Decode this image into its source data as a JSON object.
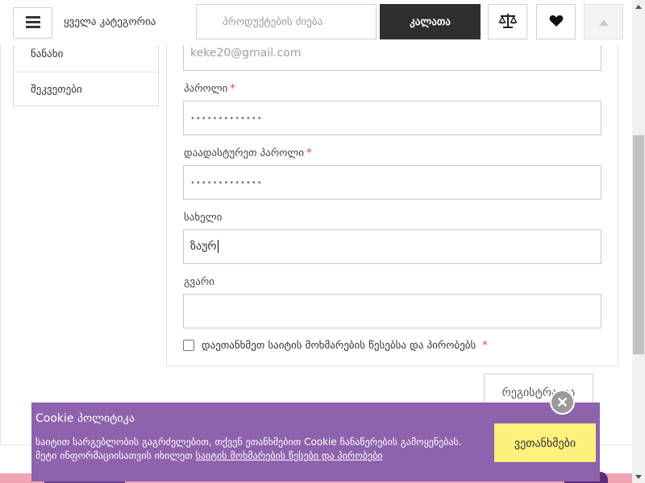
{
  "header": {
    "all_categories": "ყველა კატეგორია",
    "search_placeholder": "პროდუქტების ძიება",
    "cart_label": "კალათა"
  },
  "sidebar": {
    "items": [
      {
        "label": "ნანახი"
      },
      {
        "label": "შეკვეთები"
      }
    ]
  },
  "form": {
    "email_value": "keke20@gmail.com",
    "password_label": "პაროლი",
    "password_value": "•••••••••••••",
    "confirm_label": "დაადასტურეთ პაროლი",
    "confirm_value": "•••••••••••••",
    "name_label": "სახელი",
    "name_value": "ზაურ",
    "surname_label": "გვარი",
    "surname_value": "",
    "required_mark": "*",
    "terms_label": "დაეთანხმეთ საიტის მოხმარების წესებსა და პირობებს",
    "register_label": "რეგისტრაცია"
  },
  "cookie": {
    "title": "Cookie პოლიტიკა",
    "text": "საიტით სარგებლობის გაგრძელებით, თქვენ ეთანხმებით Cookie ჩანაწერების გამოყენებას. მეტი ინფორმაციისათვის იხილეთ ",
    "link": "საიტის მოხმარების წესები და პირობები",
    "accept_label": "ვეთანხმები",
    "close_glyph": "✕"
  },
  "colors": {
    "accent_dark": "#2f2f2f",
    "cookie_bg": "#8f62ad",
    "accept_bg": "#fdf07c",
    "required": "#e0413a"
  }
}
